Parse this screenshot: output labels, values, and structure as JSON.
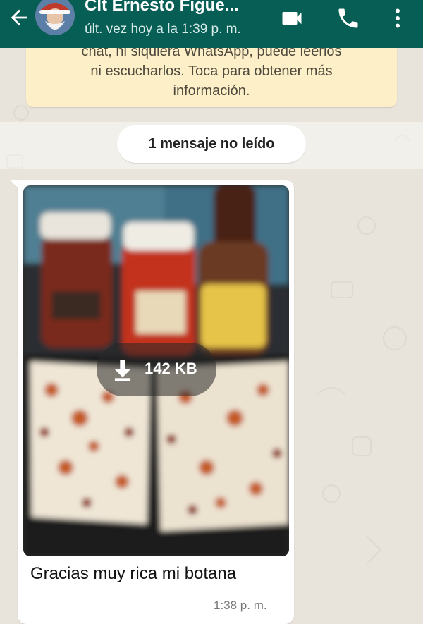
{
  "header": {
    "contact_name": "Clt Ernesto Figue...",
    "last_seen": "últ. vez hoy a la 1:39 p. m.",
    "icons": [
      "back-arrow-icon",
      "video-call-icon",
      "voice-call-icon",
      "more-options-icon"
    ]
  },
  "notice": {
    "line1": "chat, ni siquiera WhatsApp, puede leerlos",
    "line2": "ni escucharlos. Toca para obtener más",
    "line3": "información."
  },
  "unread_banner": {
    "label": "1 mensaje no leído"
  },
  "message": {
    "download_size": "142 KB",
    "caption": "Gracias muy rica mi botana",
    "time": "1:38 p. m."
  },
  "colors": {
    "header_bg": "#075e54",
    "notice_bg": "#fdf0c8",
    "chat_bg": "#e8e3db",
    "bubble_bg": "#ffffff"
  }
}
